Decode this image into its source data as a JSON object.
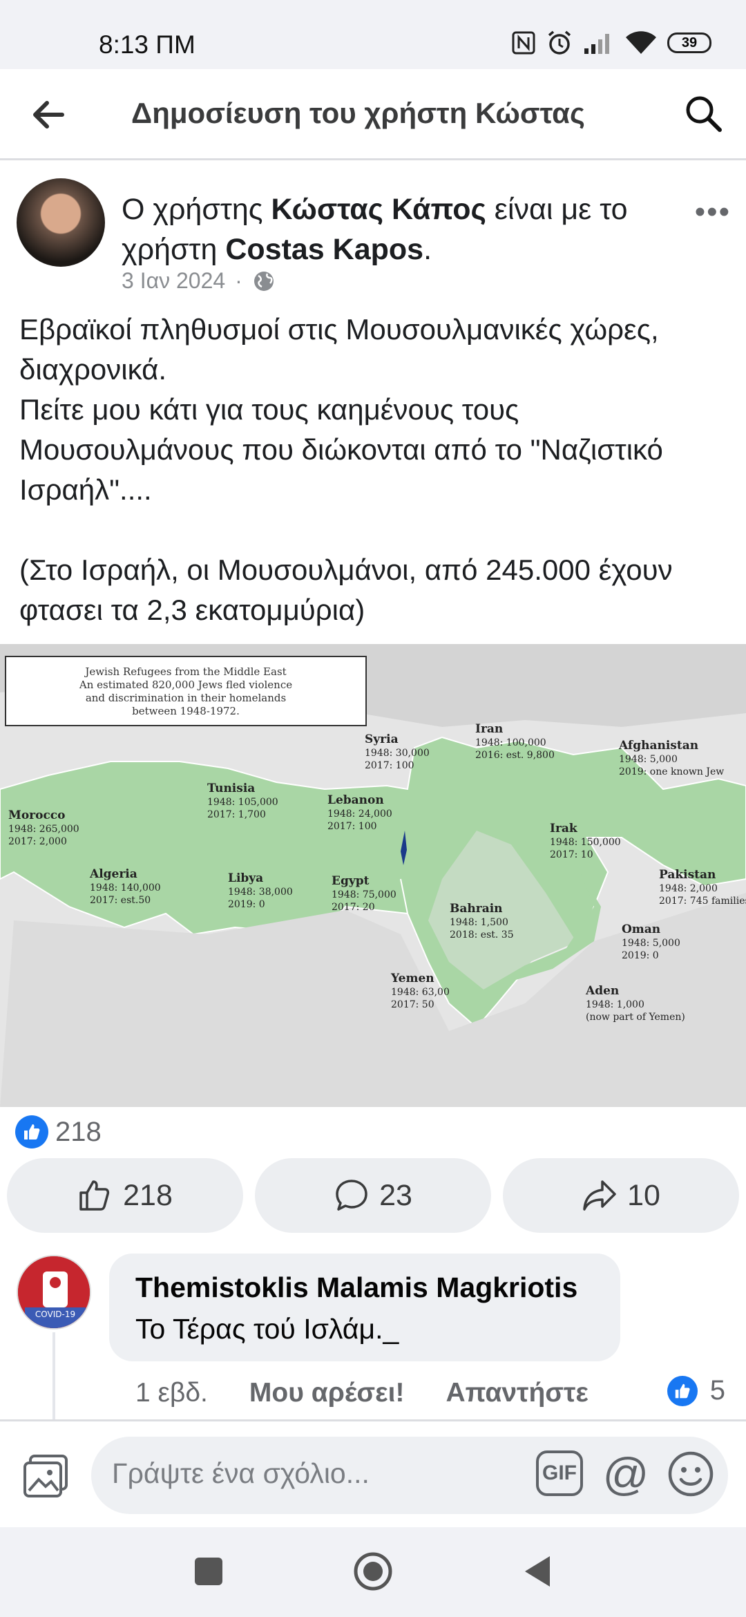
{
  "status_bar": {
    "time": "8:13 ΠΜ",
    "battery": "39"
  },
  "header": {
    "title": "Δημοσίευση του χρήστη Κώστας"
  },
  "post": {
    "author_prefix": "Ο χρήστης ",
    "author_name": "Κώστας Κάπος",
    "author_mid": " είναι με το",
    "author_line2_prefix": "χρήστη ",
    "tagged_name": "Costas Kapos",
    "author_suffix": ".",
    "date": "3 Ιαν 2024",
    "dot": "·",
    "text": "Εβραϊκοί πληθυσμοί στις Μουσουλμανικές χώρες, διαχρονικά.\nΠείτε μου κάτι για τους καημένους τους Μουσουλμάνους που διώκονται από το \"Ναζιστικό Ισραήλ\"....\n\n(Στο Ισραήλ, οι Μουσουλμάνοι, από 245.000 έχουν φτασει τα 2,3 εκατομμύρια)"
  },
  "map": {
    "caption_lines": [
      "Jewish Refugees from the Middle East",
      "An estimated 820,000 Jews fled violence",
      "and discrimination in their homelands",
      "between 1948-1972."
    ],
    "countries": [
      {
        "name": "Morocco",
        "l1": "1948: 265,000",
        "l2": "2017: 2,000"
      },
      {
        "name": "Tunisia",
        "l1": "1948: 105,000",
        "l2": "2017: 1,700"
      },
      {
        "name": "Algeria",
        "l1": "1948: 140,000",
        "l2": "2017: est.50"
      },
      {
        "name": "Libya",
        "l1": "1948: 38,000",
        "l2": "2019: 0"
      },
      {
        "name": "Egypt",
        "l1": "1948: 75,000",
        "l2": "2017: 20"
      },
      {
        "name": "Lebanon",
        "l1": "1948: 24,000",
        "l2": "2017: 100"
      },
      {
        "name": "Syria",
        "l1": "1948: 30,000",
        "l2": "2017: 100"
      },
      {
        "name": "Iran",
        "l1": "1948: 100,000",
        "l2": "2016: est. 9,800"
      },
      {
        "name": "Irak",
        "l1": "1948: 150,000",
        "l2": "2017: 10"
      },
      {
        "name": "Afghanistan",
        "l1": "1948: 5,000",
        "l2": "2019: one known Jew"
      },
      {
        "name": "Pakistan",
        "l1": "1948: 2,000",
        "l2": "2017: 745 families"
      },
      {
        "name": "Bahrain",
        "l1": "1948: 1,500",
        "l2": "2018: est. 35"
      },
      {
        "name": "Oman",
        "l1": "1948: 5,000",
        "l2": "2019: 0"
      },
      {
        "name": "Yemen",
        "l1": "1948: 63,00",
        "l2": "2017: 50"
      },
      {
        "name": "Aden",
        "l1": "1948: 1,000",
        "l2": "(now part of Yemen)"
      }
    ]
  },
  "reactions": {
    "count": "218"
  },
  "actions": {
    "like": "218",
    "comment": "23",
    "share": "10"
  },
  "comment": {
    "author": "Themistoklis Malamis Magkriotis",
    "text": "Το Τέρας τού Ισλάμ._",
    "time": "1 εβδ.",
    "like_label": "Μου αρέσει!",
    "reply_label": "Απαντήστε",
    "likes": "5"
  },
  "composer": {
    "placeholder": "Γράψτε ένα σχόλιο...",
    "gif": "GIF",
    "at": "@"
  },
  "colors": {
    "accent": "#1877f2",
    "land": "#a9d6a5",
    "sea": "#e6e6e6"
  }
}
